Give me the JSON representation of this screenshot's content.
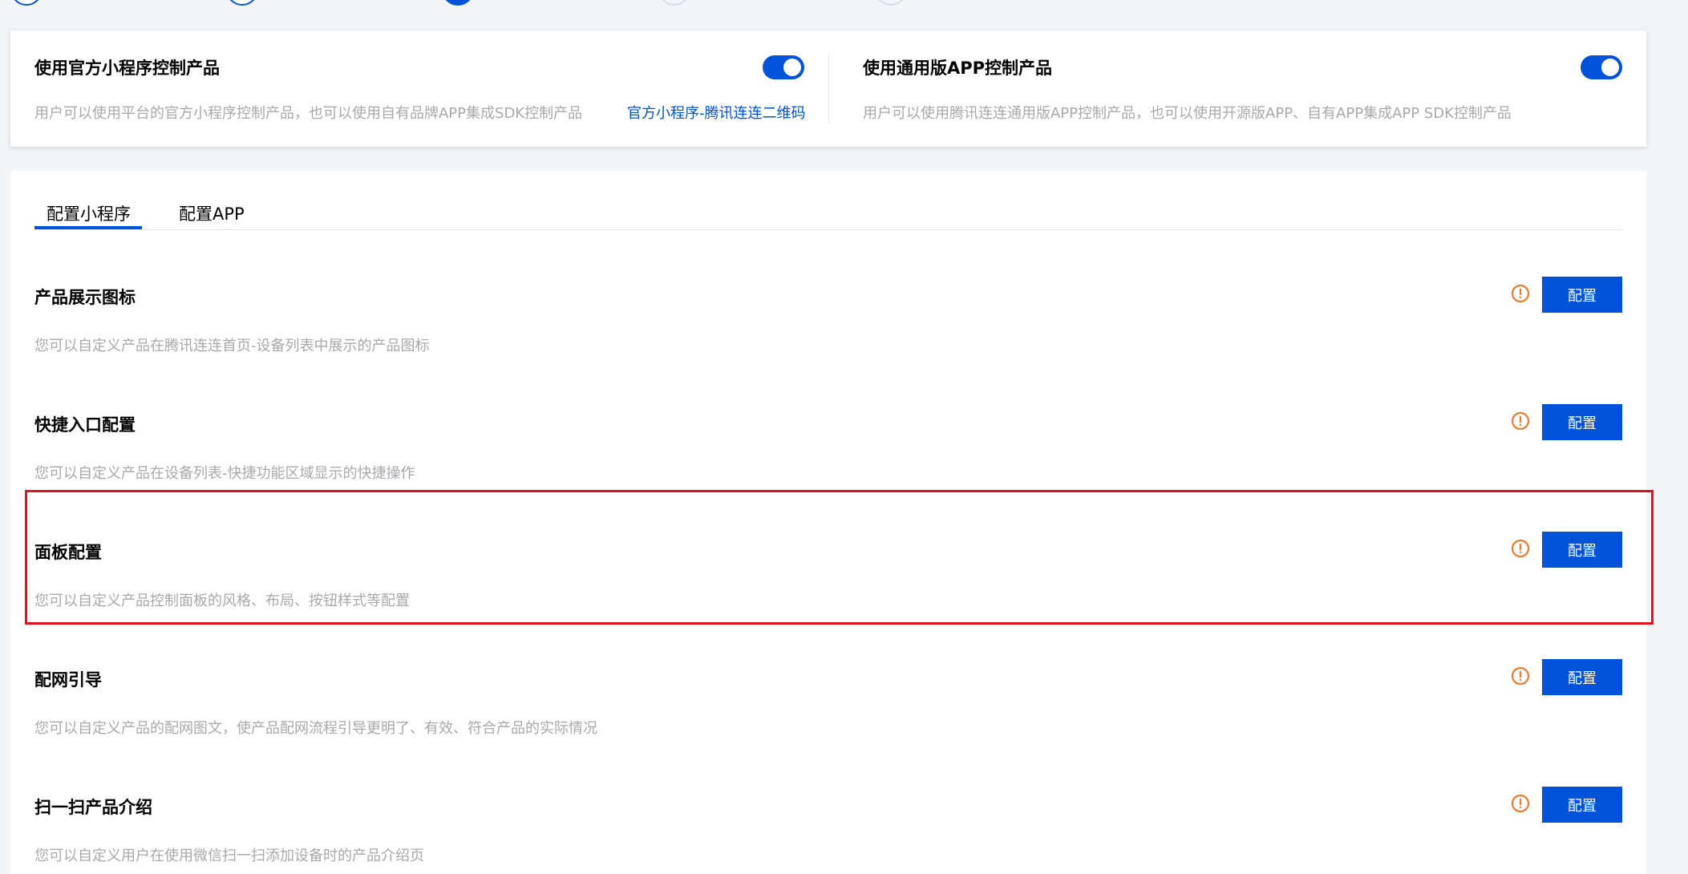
{
  "top_cards": {
    "miniprogram": {
      "title": "使用官方小程序控制产品",
      "desc": "用户可以使用平台的官方小程序控制产品，也可以使用自有品牌APP集成SDK控制产品",
      "link": "官方小程序-腾讯连连二维码",
      "enabled": true
    },
    "app": {
      "title": "使用通用版APP控制产品",
      "desc": "用户可以使用腾讯连连通用版APP控制产品，也可以使用开源版APP、自有APP集成APP SDK控制产品",
      "enabled": true
    }
  },
  "tabs": [
    {
      "label": "配置小程序",
      "active": true
    },
    {
      "label": "配置APP",
      "active": false
    }
  ],
  "sections": [
    {
      "title": "产品展示图标",
      "desc": "您可以自定义产品在腾讯连连首页-设备列表中展示的产品图标",
      "button": "配置"
    },
    {
      "title": "快捷入口配置",
      "desc": "您可以自定义产品在设备列表-快捷功能区域显示的快捷操作",
      "button": "配置"
    },
    {
      "title": "面板配置",
      "desc": "您可以自定义产品控制面板的风格、布局、按钮样式等配置",
      "button": "配置"
    },
    {
      "title": "配网引导",
      "desc": "您可以自定义产品的配网图文，使产品配网流程引导更明了、有效、符合产品的实际情况",
      "button": "配置"
    },
    {
      "title": "扫一扫产品介绍",
      "desc": "您可以自定义用户在使用微信扫一扫添加设备时的产品介绍页",
      "button": "配置"
    }
  ],
  "colors": {
    "primary": "#0052d9",
    "warning": "#ed7b2f",
    "highlight": "#e0141f",
    "muted_text": "#a8a8ae"
  },
  "icons": {
    "warning": "warning-circle-icon"
  }
}
